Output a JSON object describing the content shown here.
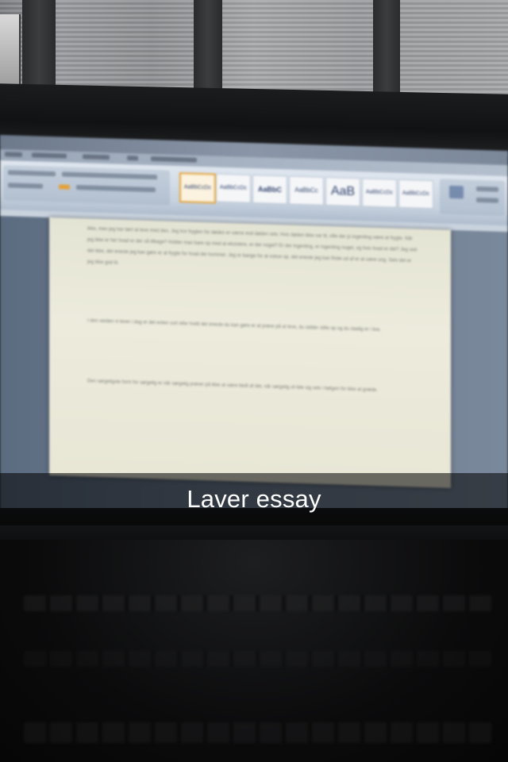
{
  "caption": {
    "text": "Laver essay"
  },
  "document": {
    "paragraphs": [
      {
        "text": "ikke, men jeg har lært at leve med den. Jeg tror frygten for døden er værre end døden selv. Hvis døden ikke var til, ville der jo ingenting være at frygte. Når jeg ikke er her hvad er der så tilbage? Holder man bare op med at eksistere, er der noget? Er der ingenting, er ingenting noget, og hvis hvad er det? Jeg ved det ikke, det eneste jeg kan gøre er at frygte for hvad der kommer. Jeg er bange for at vokse op, det eneste jeg kan finde ud af er at være ung. Selv det er jeg ikke god til."
      },
      {
        "text": "I den verden vi lever i dag er det enten sort eller hvidt det eneste du kan gøre er at prøve på at leve, du sidder stille op og du stadig er i live."
      },
      {
        "text": "Den sørgeligste form for sørgelig er når sørgelig prøver på ikke at være bedt af det, når sørgelig vil lide sig selv i bølgen for ikke at græde."
      }
    ],
    "ribbon_styles": [
      "AaBbCcDc",
      "AaBbCcDc",
      "AaBbC",
      "AaBbCc",
      "AaB",
      "AaBbCcDc",
      "AaBbCcDc"
    ]
  }
}
